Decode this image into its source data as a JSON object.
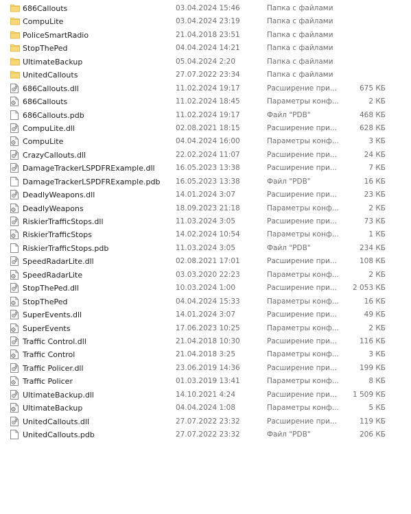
{
  "files": [
    {
      "name": "686Callouts",
      "date": "03.04.2024 15:46",
      "type": "Папка с файлами",
      "size": "",
      "icon": "folder-icon"
    },
    {
      "name": "CompuLite",
      "date": "03.04.2024 23:19",
      "type": "Папка с файлами",
      "size": "",
      "icon": "folder-icon"
    },
    {
      "name": "PoliceSmartRadio",
      "date": "21.04.2018 23:51",
      "type": "Папка с файлами",
      "size": "",
      "icon": "folder-icon"
    },
    {
      "name": "StopThePed",
      "date": "04.04.2024 14:21",
      "type": "Папка с файлами",
      "size": "",
      "icon": "folder-icon"
    },
    {
      "name": "UltimateBackup",
      "date": "05.04.2024 2:20",
      "type": "Папка с файлами",
      "size": "",
      "icon": "folder-icon"
    },
    {
      "name": "UnitedCallouts",
      "date": "27.07.2022 23:34",
      "type": "Папка с файлами",
      "size": "",
      "icon": "folder-icon"
    },
    {
      "name": "686Callouts.dll",
      "date": "11.02.2024 19:17",
      "type": "Расширение при...",
      "size": "675 КБ",
      "icon": "dll-file-icon"
    },
    {
      "name": "686Callouts",
      "date": "11.02.2024 18:45",
      "type": "Параметры конф...",
      "size": "2 КБ",
      "icon": "config-file-icon"
    },
    {
      "name": "686Callouts.pdb",
      "date": "11.02.2024 19:17",
      "type": "Файл \"PDB\"",
      "size": "468 КБ",
      "icon": "blank-file-icon"
    },
    {
      "name": "CompuLite.dll",
      "date": "02.08.2021 18:15",
      "type": "Расширение при...",
      "size": "628 КБ",
      "icon": "dll-file-icon"
    },
    {
      "name": "CompuLite",
      "date": "04.04.2024 16:00",
      "type": "Параметры конф...",
      "size": "3 КБ",
      "icon": "config-file-icon"
    },
    {
      "name": "CrazyCallouts.dll",
      "date": "22.02.2024 11:07",
      "type": "Расширение при...",
      "size": "24 КБ",
      "icon": "dll-file-icon"
    },
    {
      "name": "DamageTrackerLSPDFRExample.dll",
      "date": "16.05.2023 13:38",
      "type": "Расширение при...",
      "size": "7 КБ",
      "icon": "dll-file-icon"
    },
    {
      "name": "DamageTrackerLSPDFRExample.pdb",
      "date": "16.05.2023 13:38",
      "type": "Файл \"PDB\"",
      "size": "16 КБ",
      "icon": "blank-file-icon"
    },
    {
      "name": "DeadlyWeapons.dll",
      "date": "14.01.2024 3:07",
      "type": "Расширение при...",
      "size": "23 КБ",
      "icon": "dll-file-icon"
    },
    {
      "name": "DeadlyWeapons",
      "date": "18.09.2023 21:18",
      "type": "Параметры конф...",
      "size": "2 КБ",
      "icon": "config-file-icon"
    },
    {
      "name": "RiskierTrafficStops.dll",
      "date": "11.03.2024 3:05",
      "type": "Расширение при...",
      "size": "73 КБ",
      "icon": "dll-file-icon"
    },
    {
      "name": "RiskierTrafficStops",
      "date": "14.02.2024 10:54",
      "type": "Параметры конф...",
      "size": "1 КБ",
      "icon": "config-file-icon"
    },
    {
      "name": "RiskierTrafficStops.pdb",
      "date": "11.03.2024 3:05",
      "type": "Файл \"PDB\"",
      "size": "234 КБ",
      "icon": "blank-file-icon"
    },
    {
      "name": "SpeedRadarLite.dll",
      "date": "02.08.2021 17:01",
      "type": "Расширение при...",
      "size": "108 КБ",
      "icon": "dll-file-icon"
    },
    {
      "name": "SpeedRadarLite",
      "date": "03.03.2020 22:23",
      "type": "Параметры конф...",
      "size": "2 КБ",
      "icon": "config-file-icon"
    },
    {
      "name": "StopThePed.dll",
      "date": "10.03.2024 1:00",
      "type": "Расширение при...",
      "size": "2 053 КБ",
      "icon": "dll-file-icon"
    },
    {
      "name": "StopThePed",
      "date": "04.04.2024 15:33",
      "type": "Параметры конф...",
      "size": "16 КБ",
      "icon": "config-file-icon"
    },
    {
      "name": "SuperEvents.dll",
      "date": "14.01.2024 3:07",
      "type": "Расширение при...",
      "size": "49 КБ",
      "icon": "dll-file-icon"
    },
    {
      "name": "SuperEvents",
      "date": "17.06.2023 10:25",
      "type": "Параметры конф...",
      "size": "2 КБ",
      "icon": "config-file-icon"
    },
    {
      "name": "Traffic Control.dll",
      "date": "21.04.2018 10:30",
      "type": "Расширение при...",
      "size": "116 КБ",
      "icon": "dll-file-icon"
    },
    {
      "name": "Traffic Control",
      "date": "21.04.2018 3:25",
      "type": "Параметры конф...",
      "size": "3 КБ",
      "icon": "config-file-icon"
    },
    {
      "name": "Traffic Policer.dll",
      "date": "23.06.2019 14:36",
      "type": "Расширение при...",
      "size": "199 КБ",
      "icon": "dll-file-icon"
    },
    {
      "name": "Traffic Policer",
      "date": "01.03.2019 13:41",
      "type": "Параметры конф...",
      "size": "8 КБ",
      "icon": "config-file-icon"
    },
    {
      "name": "UltimateBackup.dll",
      "date": "14.10.2021 4:24",
      "type": "Расширение при...",
      "size": "1 509 КБ",
      "icon": "dll-file-icon"
    },
    {
      "name": "UltimateBackup",
      "date": "04.04.2024 1:08",
      "type": "Параметры конф...",
      "size": "5 КБ",
      "icon": "config-file-icon"
    },
    {
      "name": "UnitedCallouts.dll",
      "date": "27.07.2022 23:32",
      "type": "Расширение при...",
      "size": "119 КБ",
      "icon": "dll-file-icon"
    },
    {
      "name": "UnitedCallouts.pdb",
      "date": "27.07.2022 23:32",
      "type": "Файл \"PDB\"",
      "size": "206 КБ",
      "icon": "blank-file-icon"
    }
  ],
  "colors": {
    "folder": "#f8d775",
    "folder_dark": "#e0b040",
    "file_border": "#8a8a8a",
    "text_secondary": "#6d6d6d"
  }
}
